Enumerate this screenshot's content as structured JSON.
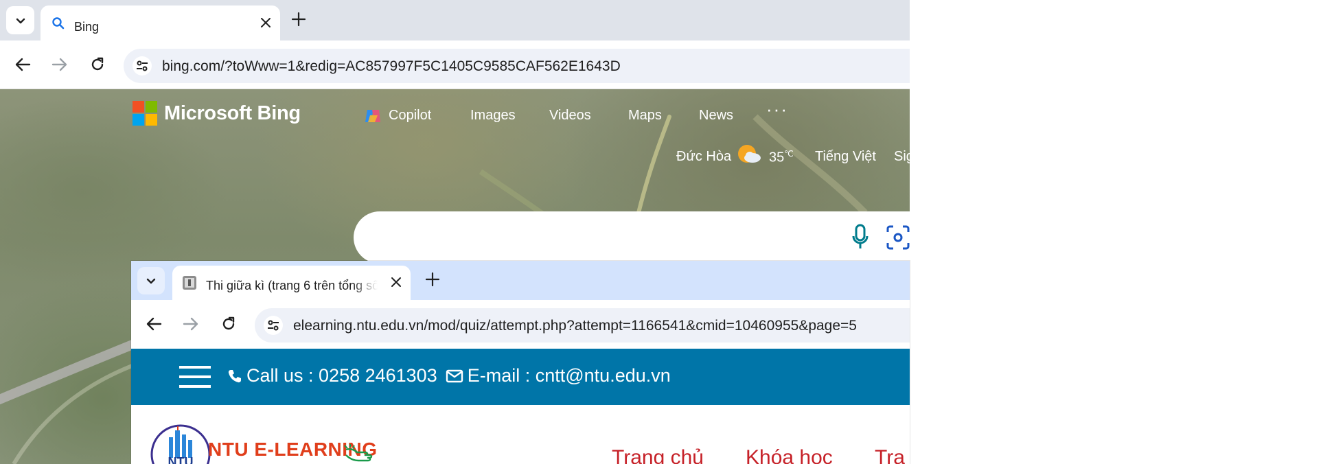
{
  "back_window": {
    "tab_title": "Bing",
    "url": "bing.com/?toWww=1&redig=AC857997F5C1405C9585CAF562E1643D",
    "bing": {
      "logo_text": "Microsoft Bing",
      "nav": [
        "Copilot",
        "Images",
        "Videos",
        "Maps",
        "News"
      ],
      "more_label": "···",
      "location": "Đức Hòa",
      "temperature": "35",
      "temperature_unit": "℃",
      "language": "Tiếng Việt",
      "sign_in": "Sig"
    }
  },
  "front_window": {
    "tab_title": "Thi giữa kì (trang 6 trên tổng số",
    "url": "elearning.ntu.edu.vn/mod/quiz/attempt.php?attempt=1166541&cmid=10460955&page=5",
    "ntu": {
      "call_text": "Call us : 0258 2461303",
      "email_text": "E-mail : cntt@ntu.edu.vn",
      "brand": "NTU E-LEARNING",
      "logo_text": "NTU",
      "menu": [
        "Trang chủ",
        "Khóa học",
        "Tra"
      ]
    }
  },
  "icons": [
    "tab-list-icon",
    "search-favicon",
    "close-icon",
    "plus-icon",
    "back-icon",
    "forward-icon",
    "reload-icon",
    "site-settings-icon",
    "microphone-icon",
    "visual-search-icon",
    "phone-icon",
    "envelope-icon",
    "hamburger-icon",
    "hand-pointer-icon",
    "weather-icon"
  ],
  "colors": {
    "ntu_bar": "#0075a8",
    "ntu_brand": "#e03e1b",
    "ntu_menu": "#c62128",
    "front_tabstrip": "#d3e3fd",
    "back_tabstrip": "#dfe3ea"
  }
}
